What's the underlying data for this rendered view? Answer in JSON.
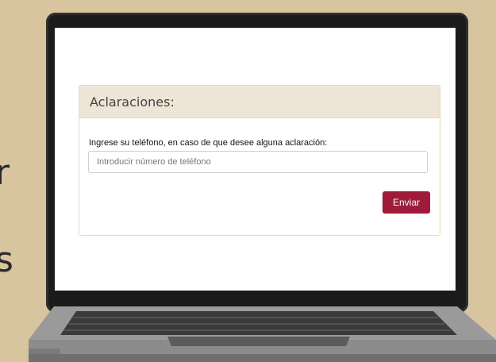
{
  "background": {
    "color": "#d8c5a0",
    "partial_text": [
      "r",
      "s"
    ]
  },
  "panel": {
    "title": "Aclaraciones:",
    "field_label": "Ingrese su teléfono, en caso de que desee alguna aclaración:",
    "phone_placeholder": "Introducir número de teléfono",
    "phone_value": "",
    "submit_label": "Enviar",
    "accent_color": "#9e1b3a",
    "heading_bg": "#efe5d6"
  }
}
